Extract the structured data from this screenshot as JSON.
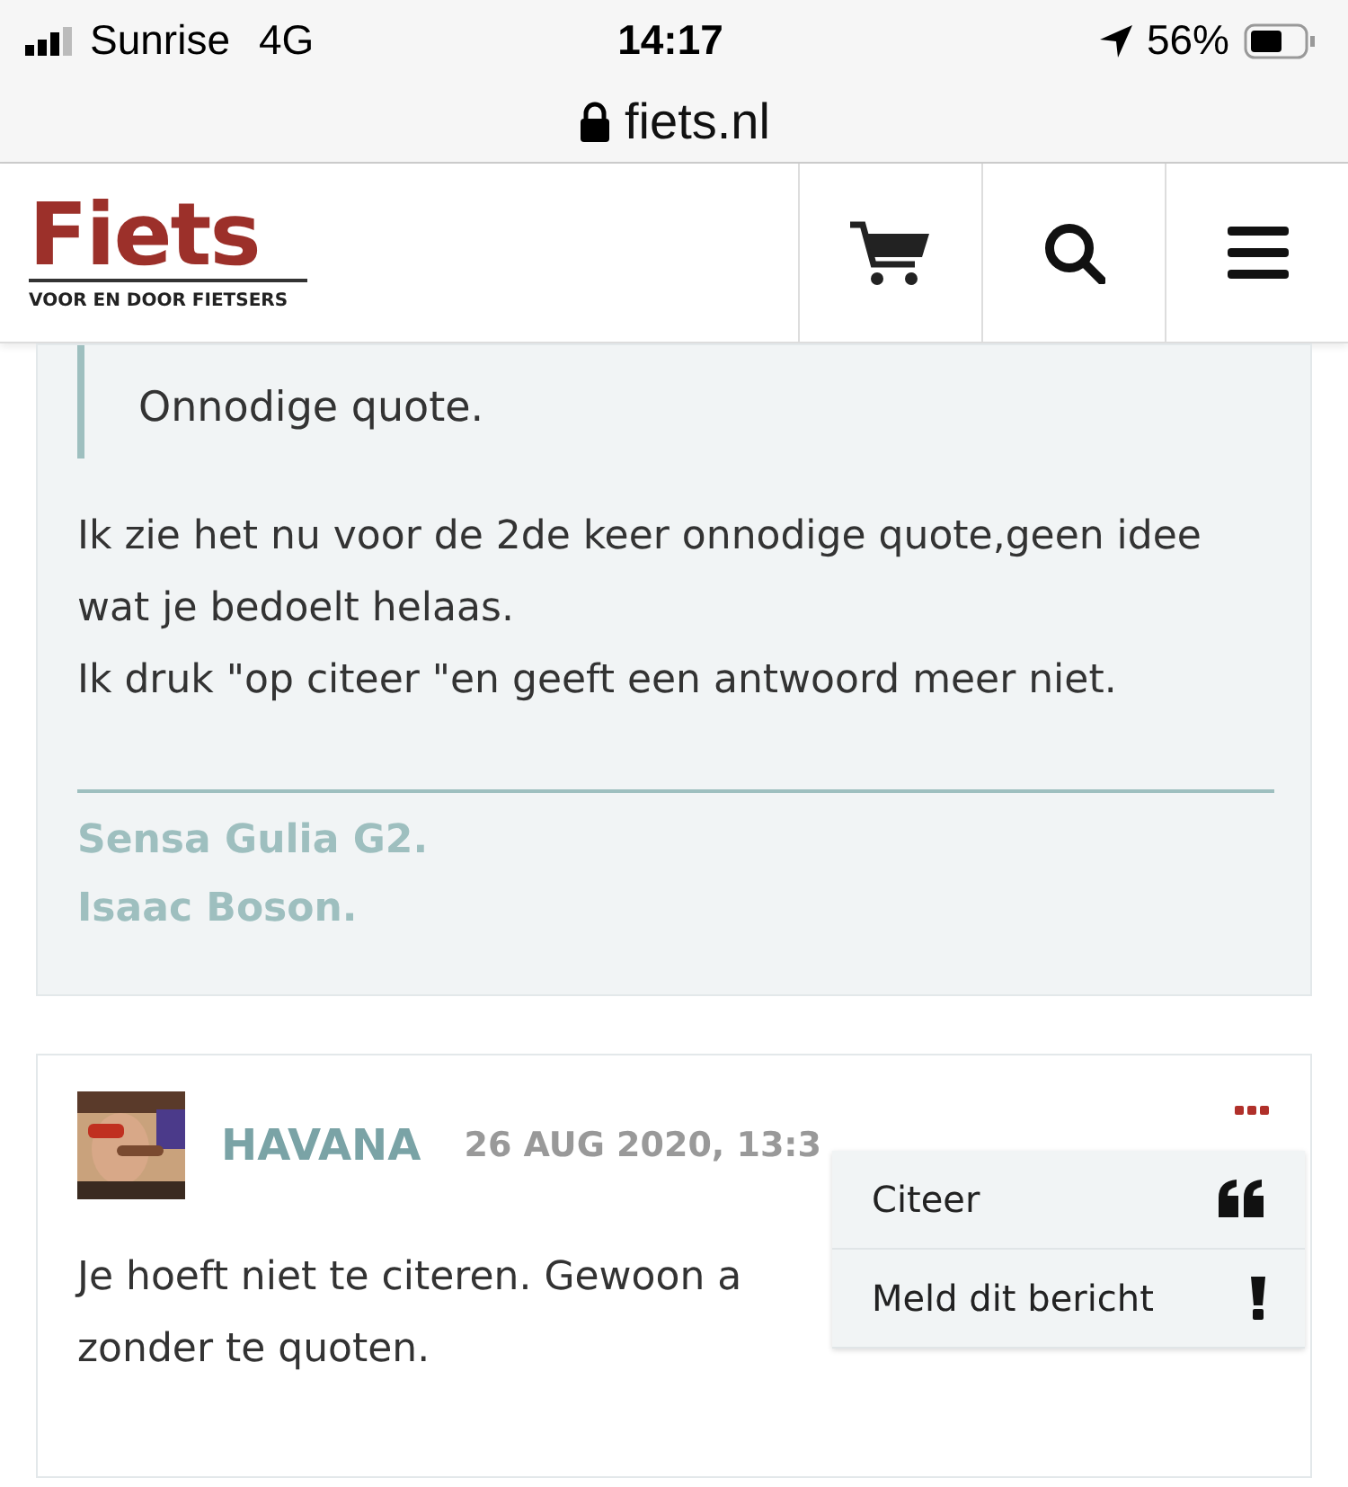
{
  "status_bar": {
    "carrier": "Sunrise",
    "network": "4G",
    "time": "14:17",
    "battery": "56%"
  },
  "address_bar": {
    "url": "fiets.nl"
  },
  "header": {
    "logo": "Fiets",
    "tagline": "VOOR EN DOOR FIETSERS"
  },
  "posts": [
    {
      "quote": "Onnodige quote.",
      "lines": [
        "Ik zie het nu voor de 2de keer onnodige quote,geen idee wat je bedoelt helaas.",
        "Ik druk \"op citeer \"en geeft een antwoord meer niet."
      ],
      "signature": [
        "Sensa Gulia G2.",
        "Isaac Boson."
      ]
    },
    {
      "author": "HAVANA",
      "date": "26 AUG 2020, 13:3",
      "lines": [
        "Je hoeft niet te citeren. Gewoon a",
        "zonder te quoten."
      ],
      "menu": [
        {
          "kind": "quote",
          "label": "Citeer"
        },
        {
          "kind": "report",
          "label": "Meld dit bericht"
        }
      ]
    }
  ]
}
